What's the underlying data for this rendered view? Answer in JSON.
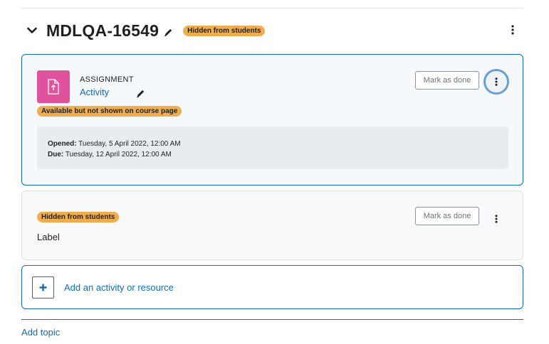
{
  "section": {
    "title": "MDLQA-16549",
    "badge": "Hidden from students"
  },
  "activity": {
    "type": "ASSIGNMENT",
    "name": "Activity",
    "availability_badge": "Available but not shown on course page",
    "mark_done_label": "Mark as done",
    "opened_label": "Opened:",
    "opened_value": "Tuesday, 5 April 2022, 12:00 AM",
    "due_label": "Due:",
    "due_value": "Tuesday, 12 April 2022, 12:00 AM",
    "icon_color": "#e0529c"
  },
  "label_item": {
    "badge": "Hidden from students",
    "text": "Label",
    "mark_done_label": "Mark as done"
  },
  "add_activity": {
    "label": "Add an activity or resource"
  },
  "footer": {
    "add_topic": "Add topic"
  },
  "colors": {
    "link": "#0f6cbf",
    "badge_warning": "#f0ad4e"
  }
}
